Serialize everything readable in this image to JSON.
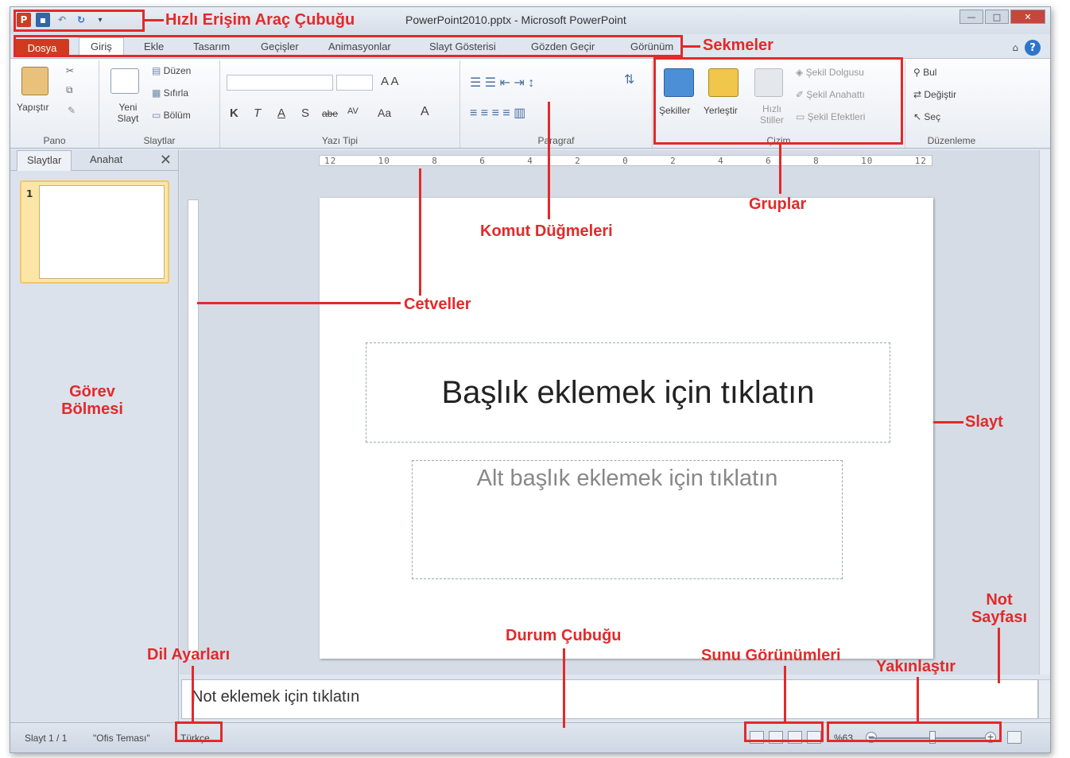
{
  "window": {
    "title": "PowerPoint2010.pptx - Microsoft PowerPoint"
  },
  "qat": {
    "app_icon": "P"
  },
  "tabs": {
    "file": "Dosya",
    "home": "Giriş",
    "insert": "Ekle",
    "design": "Tasarım",
    "transitions": "Geçişler",
    "animations": "Animasyonlar",
    "slideshow": "Slayt Gösterisi",
    "review": "Gözden Geçir",
    "view": "Görünüm"
  },
  "ribbon": {
    "clipboard": {
      "paste": "Yapıştır",
      "label": "Pano"
    },
    "slides": {
      "new_slide": "Yeni Slayt",
      "layout": "Düzen",
      "reset": "Sıfırla",
      "section": "Bölüm",
      "label": "Slaytlar"
    },
    "font": {
      "bold": "K",
      "italic": "T",
      "underline": "A",
      "shadow": "S",
      "strike": "abe",
      "spacing": "AV",
      "case": "Aa",
      "color": "A",
      "label": "Yazı Tipi"
    },
    "paragraph": {
      "label": "Paragraf"
    },
    "drawing": {
      "shapes": "Şekiller",
      "arrange": "Yerleştir",
      "quick_styles": "Hızlı Stiller",
      "fill": "Şekil Dolgusu",
      "outline": "Şekil Anahattı",
      "effects": "Şekil Efektleri",
      "label": "Çizim"
    },
    "editing": {
      "find": "Bul",
      "replace": "Değiştir",
      "select": "Seç",
      "label": "Düzenleme"
    }
  },
  "pane": {
    "tab_slides": "Slaytlar",
    "tab_outline": "Anahat",
    "close": "✕",
    "slide_num": "1"
  },
  "ruler": {
    "ticks": [
      "12",
      "10",
      "8",
      "6",
      "4",
      "2",
      "0",
      "2",
      "4",
      "6",
      "8",
      "10",
      "12"
    ]
  },
  "slide": {
    "title_placeholder": "Başlık eklemek için tıklatın",
    "subtitle_placeholder": "Alt başlık eklemek için tıklatın"
  },
  "notes": {
    "placeholder": "Not eklemek için tıklatın"
  },
  "status": {
    "slide": "Slayt 1 / 1",
    "theme": "\"Ofis Teması\"",
    "language": "Türkçe",
    "zoom": "%63",
    "zoom_level": 0.5
  },
  "annotations": {
    "qat": "Hızlı Erişim Araç Çubuğu",
    "tabs": "Sekmeler",
    "groups": "Gruplar",
    "commands": "Komut Düğmeleri",
    "rulers": "Cetveller",
    "task_pane": "Görev Bölmesi",
    "slide": "Slayt",
    "notes_page": "Not Sayfası",
    "zoom": "Yakınlaştır",
    "views": "Sunu Görünümleri",
    "status_bar": "Durum Çubuğu",
    "language": "Dil Ayarları"
  },
  "colors": {
    "accent": "#d03b1f",
    "annotation": "#e22a2a",
    "ribbon_bg": "#e8edf3"
  }
}
